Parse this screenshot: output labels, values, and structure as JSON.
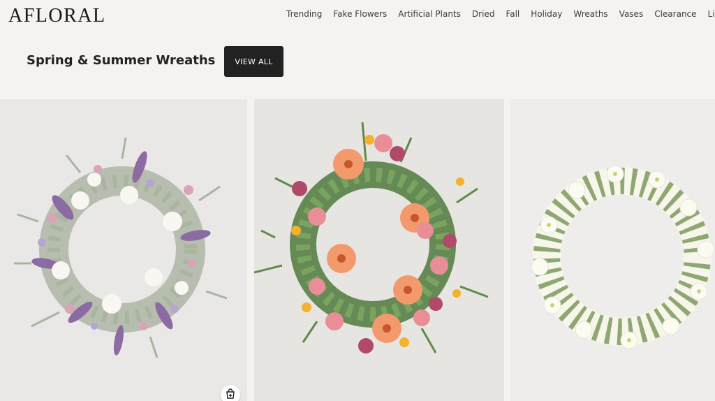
{
  "brand": {
    "logo": "AFLORAL"
  },
  "nav": {
    "items": [
      "Trending",
      "Fake Flowers",
      "Artificial Plants",
      "Dried",
      "Fall",
      "Holiday",
      "Wreaths",
      "Vases",
      "Clearance",
      "Live Pla"
    ]
  },
  "section": {
    "title": "Spring & Summer Wreaths",
    "view_all": "VIEW ALL"
  },
  "products": [
    {
      "image": "lavender-pink-white-wreath"
    },
    {
      "image": "peach-gerbera-daisy-wreath"
    },
    {
      "image": "white-blossom-wreath"
    }
  ],
  "icons": {
    "quick_add": "shopping-bag-plus-icon"
  },
  "colors": {
    "background": "#f4f3f0",
    "button": "#222222"
  }
}
